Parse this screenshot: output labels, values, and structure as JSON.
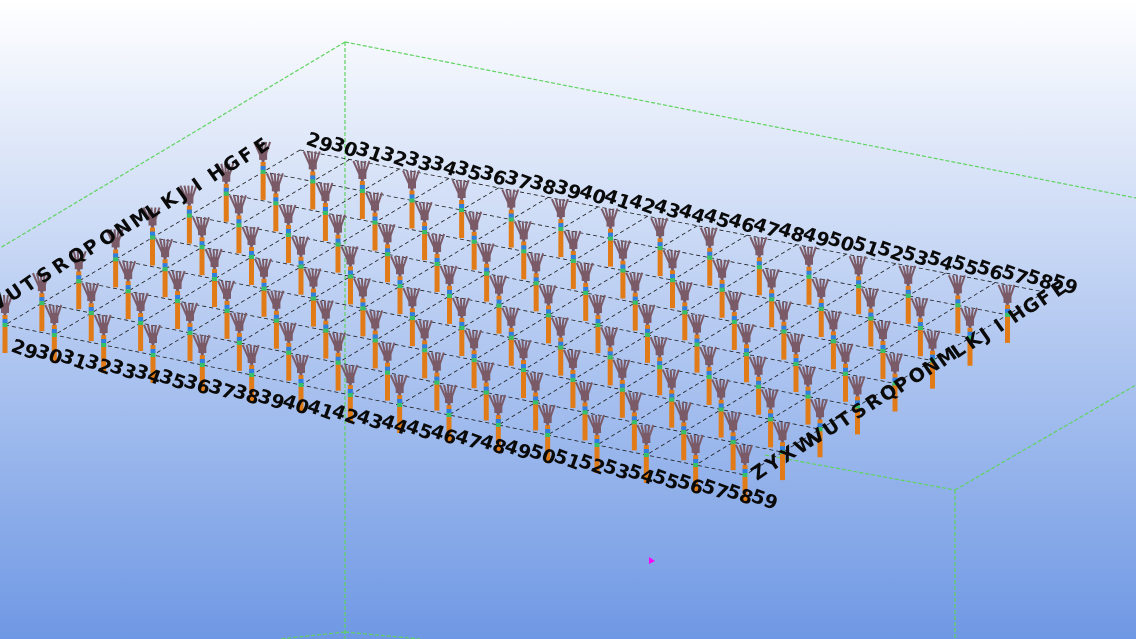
{
  "colors": {
    "background_top": "#ffffff",
    "background_bottom": "#6f98e4",
    "bounding_box": "#5fd35f",
    "grid_line": "#1a1a1a",
    "column_shaft": "#e07b18",
    "column_head": "#7a5a66",
    "column_band_blue": "#2f7fe0",
    "column_band_green": "#37c06a",
    "cursor_marker": "#ff00ff"
  },
  "model": {
    "row_axis_letters": [
      "E",
      "F",
      "G",
      "H",
      "I",
      "J",
      "K",
      "L",
      "M",
      "N",
      "O",
      "P",
      "Q",
      "R",
      "S",
      "T",
      "U",
      "V",
      "W",
      "X",
      "Y",
      "Z"
    ],
    "column_axis_numbers_start": 29,
    "column_axis_numbers_end": 58,
    "near_front_row_start": 29,
    "left_front_labels_start": 29
  }
}
